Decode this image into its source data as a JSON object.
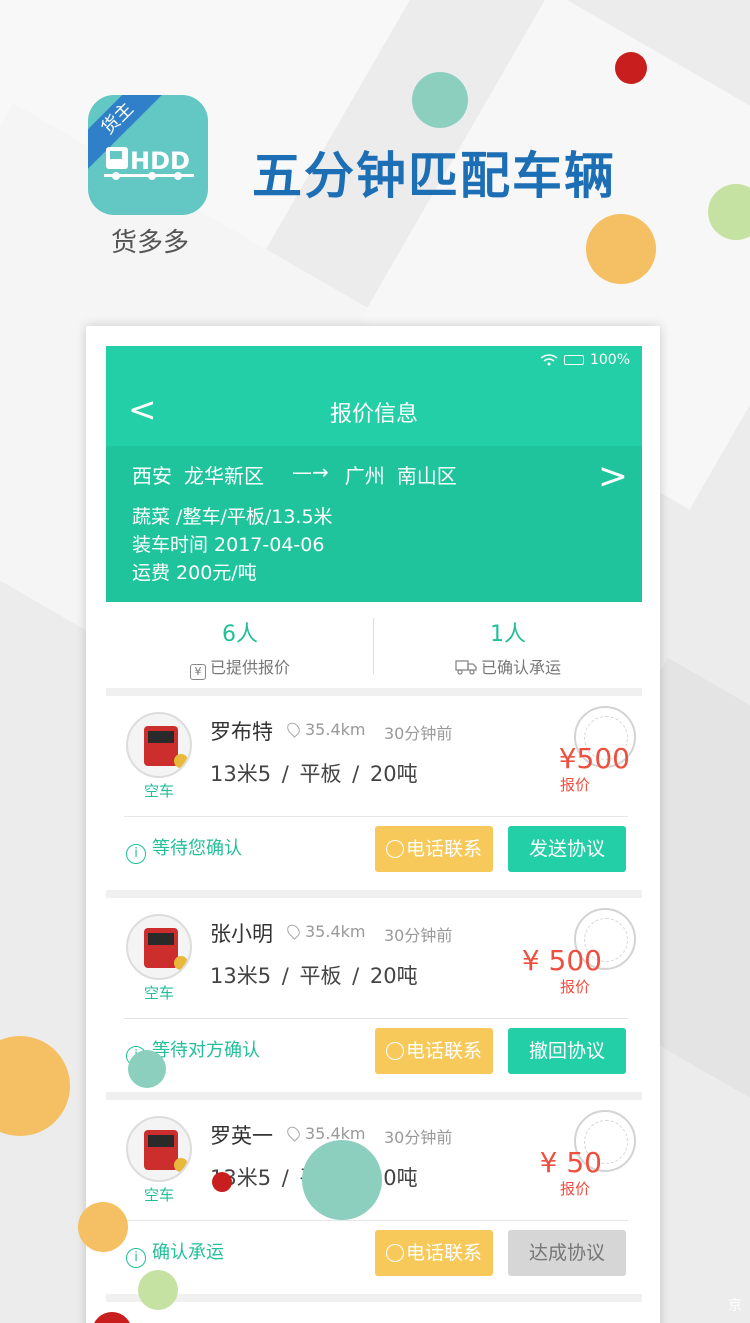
{
  "app": {
    "badge": "货主",
    "name": "货多多",
    "slogan": "五分钟匹配车辆"
  },
  "status_bar": {
    "battery": "100%"
  },
  "nav": {
    "back": "<",
    "title": "报价信息",
    "next": ">"
  },
  "route": {
    "from_city": "西安",
    "from_district": "龙华新区",
    "arrow": "—→",
    "to_city": "广州",
    "to_district": "南山区",
    "cargo": "蔬菜 /整车/平板/13.5米",
    "loading_time": "装车时间 2017-04-06",
    "freight": "运费 200元/吨"
  },
  "stats": {
    "offered_count": "6人",
    "offered_label": "已提供报价",
    "offered_icon": "¥",
    "confirmed_count": "1人",
    "confirmed_label": "已确认承运"
  },
  "quotes": [
    {
      "empty": "空车",
      "name": "罗布特",
      "distance": "35.4km",
      "time": "30分钟前",
      "spec": "13米5 / 平板 / 20吨",
      "price": "¥500",
      "price_label": "报价",
      "status": "等待您确认",
      "call": "电话联系",
      "action": "发送协议"
    },
    {
      "empty": "空车",
      "name": "张小明",
      "distance": "35.4km",
      "time": "30分钟前",
      "spec": "13米5 / 平板 / 20吨",
      "price": "¥ 500",
      "price_label": "报价",
      "status": "等待对方确认",
      "call": "电话联系",
      "action": "撤回协议"
    },
    {
      "empty": "空车",
      "name": "罗英一",
      "distance": "35.4km",
      "time": "30分钟前",
      "spec": "13米5 / 平板 / 20吨",
      "price": "¥ 50",
      "price_label": "报价",
      "status": "确认承运",
      "call": "电话联系",
      "action": "达成协议"
    }
  ],
  "watermark": "京"
}
